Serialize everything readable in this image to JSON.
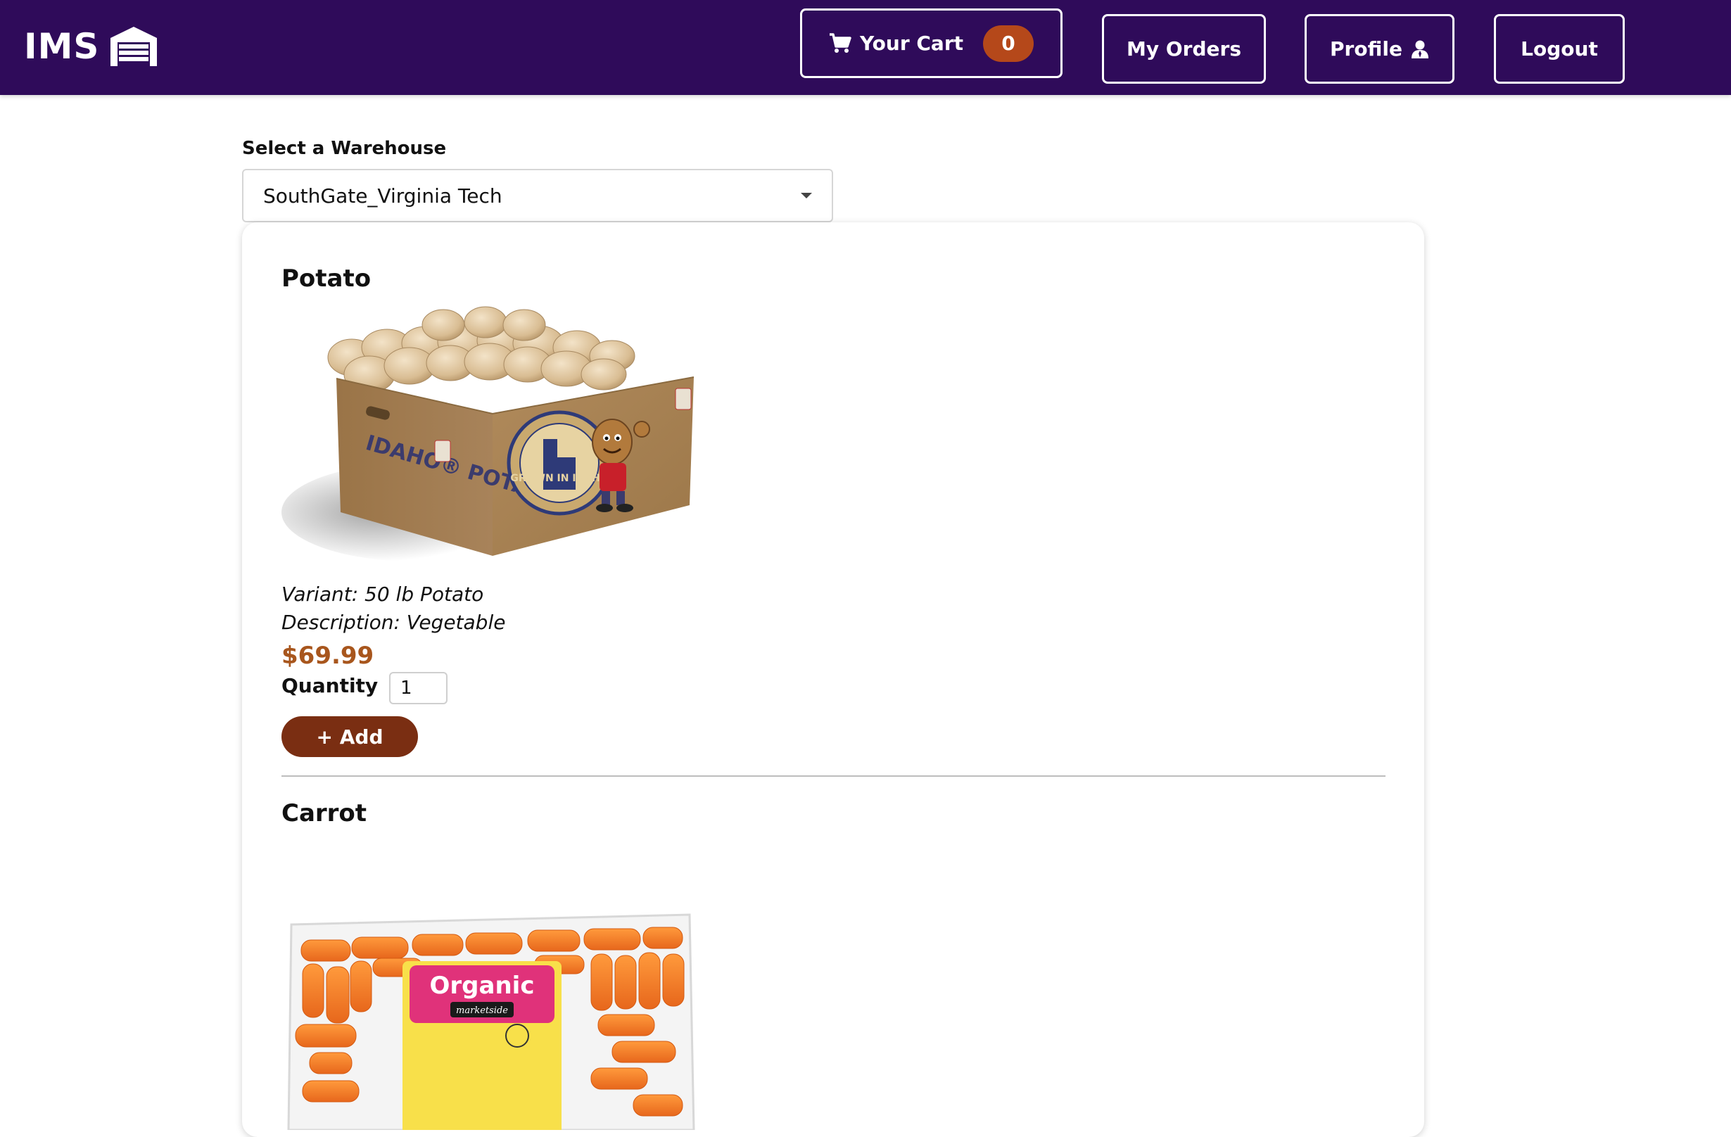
{
  "header": {
    "logo_text": "IMS",
    "cart_label": "Your Cart",
    "cart_count": "0",
    "orders_label": "My Orders",
    "profile_label": "Profile",
    "logout_label": "Logout"
  },
  "warehouse": {
    "label": "Select a Warehouse",
    "selected": "SouthGate_Virginia Tech"
  },
  "products": [
    {
      "name": "Potato",
      "variant": "Variant: 50 lb Potato",
      "description": "Description: Vegetable",
      "price": "$69.99",
      "quantity_label": "Quantity",
      "quantity_value": "1",
      "add_label": "+ Add",
      "image_icon": "potato-box-image",
      "box_text": "IDAHO® POTATOES",
      "seal_text": "GROWN IN IDAHO"
    },
    {
      "name": "Carrot",
      "image_icon": "carrot-bag-image",
      "bag_label": "Organic",
      "bag_brand": "marketside"
    }
  ],
  "colors": {
    "header_bg": "#2f0b5a",
    "badge": "#b5481a",
    "price": "#a8561d",
    "add_button": "#7a2e12"
  }
}
